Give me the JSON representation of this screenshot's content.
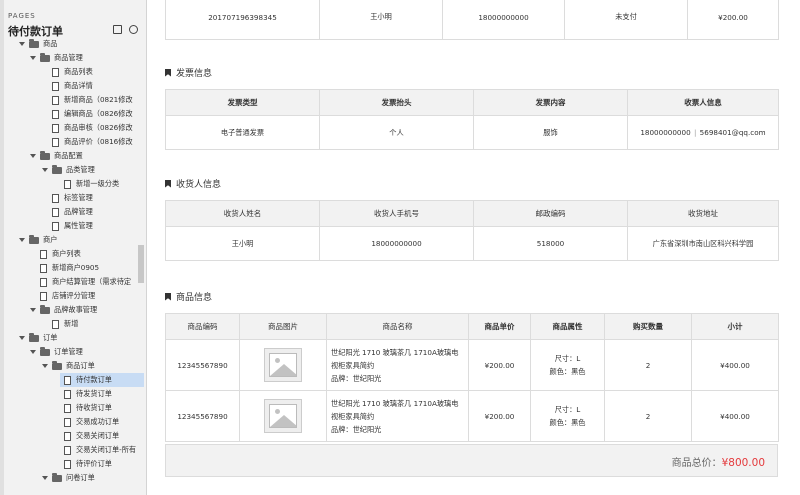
{
  "sidebar": {
    "pages_label": "PAGES",
    "title": "待付款订单",
    "tree": [
      {
        "label": "商品",
        "type": "folder",
        "expanded": true,
        "level": 1
      },
      {
        "label": "商品管理",
        "type": "folder",
        "expanded": true,
        "level": 2
      },
      {
        "label": "商品列表",
        "type": "doc",
        "level": 3
      },
      {
        "label": "商品详情",
        "type": "doc",
        "level": 3
      },
      {
        "label": "新增商品（0821修改",
        "type": "doc",
        "level": 3
      },
      {
        "label": "编辑商品（0826修改",
        "type": "doc",
        "level": 3
      },
      {
        "label": "商品审核（0826修改",
        "type": "doc",
        "level": 3
      },
      {
        "label": "商品评价（0816修改",
        "type": "doc",
        "level": 3
      },
      {
        "label": "商品配置",
        "type": "folder",
        "expanded": true,
        "level": 2
      },
      {
        "label": "品类管理",
        "type": "folder",
        "expanded": true,
        "level": 3
      },
      {
        "label": "新增一级分类",
        "type": "doc",
        "level": 4
      },
      {
        "label": "标签管理",
        "type": "doc",
        "level": 3
      },
      {
        "label": "品牌管理",
        "type": "doc",
        "level": 3
      },
      {
        "label": "属性管理",
        "type": "doc",
        "level": 3
      },
      {
        "label": "商户",
        "type": "folder",
        "expanded": true,
        "level": 1
      },
      {
        "label": "商户列表",
        "type": "doc",
        "level": 2
      },
      {
        "label": "新增商户0905",
        "type": "doc",
        "level": 2
      },
      {
        "label": "商户结算管理（需求待定",
        "type": "doc",
        "level": 2
      },
      {
        "label": "店铺评分管理",
        "type": "doc",
        "level": 2
      },
      {
        "label": "品牌故事管理",
        "type": "folder",
        "expanded": true,
        "level": 2
      },
      {
        "label": "新增",
        "type": "doc",
        "level": 3
      },
      {
        "label": "订单",
        "type": "folder",
        "expanded": true,
        "level": 1
      },
      {
        "label": "订单管理",
        "type": "folder",
        "expanded": true,
        "level": 2
      },
      {
        "label": "商品订单",
        "type": "folder",
        "expanded": true,
        "level": 3
      },
      {
        "label": "待付款订单",
        "type": "doc",
        "level": 4,
        "selected": true
      },
      {
        "label": "待发货订单",
        "type": "doc",
        "level": 4
      },
      {
        "label": "待收货订单",
        "type": "doc",
        "level": 4
      },
      {
        "label": "交易成功订单",
        "type": "doc",
        "level": 4
      },
      {
        "label": "交易关闭订单",
        "type": "doc",
        "level": 4
      },
      {
        "label": "交易关闭订单-所有",
        "type": "doc",
        "level": 4
      },
      {
        "label": "待评价订单",
        "type": "doc",
        "level": 4
      },
      {
        "label": "问卷订单",
        "type": "folder",
        "expanded": true,
        "level": 3
      }
    ]
  },
  "order_row": [
    "201707196398345",
    "王小明",
    "18000000000",
    "未支付",
    "¥200.00"
  ],
  "invoice": {
    "title": "发票信息",
    "headers": [
      "发票类型",
      "发票抬头",
      "发票内容",
      "收票人信息"
    ],
    "row": {
      "type": "电子普通发票",
      "header": "个人",
      "content": "服饰",
      "phone": "18000000000",
      "sep": "|",
      "email": "5698401@qq.com"
    }
  },
  "consignee": {
    "title": "收货人信息",
    "headers": [
      "收货人姓名",
      "收货人手机号",
      "邮政编码",
      "收货地址"
    ],
    "row": [
      "王小明",
      "18000000000",
      "518000",
      "广东省深圳市南山区科兴科学园"
    ]
  },
  "goods": {
    "title": "商品信息",
    "headers": [
      "商品编码",
      "商品图片",
      "商品名称",
      "商品单价",
      "商品属性",
      "购买数量",
      "小计"
    ],
    "rows": [
      {
        "code": "12345567890",
        "name": "世纪阳光 1710 玻璃茶几 1710A玻璃电视柜家具简约",
        "brand": "品牌：世纪阳光",
        "price": "¥200.00",
        "size": "尺寸：L",
        "color": "颜色：黑色",
        "qty": "2",
        "subtotal": "¥400.00"
      },
      {
        "code": "12345567890",
        "name": "世纪阳光 1710 玻璃茶几 1710A玻璃电视柜家具简约",
        "brand": "品牌：世纪阳光",
        "price": "¥200.00",
        "size": "尺寸：L",
        "color": "颜色：黑色",
        "qty": "2",
        "subtotal": "¥400.00"
      }
    ],
    "total_label": "商品总价：",
    "total_amount": "¥800.00"
  }
}
